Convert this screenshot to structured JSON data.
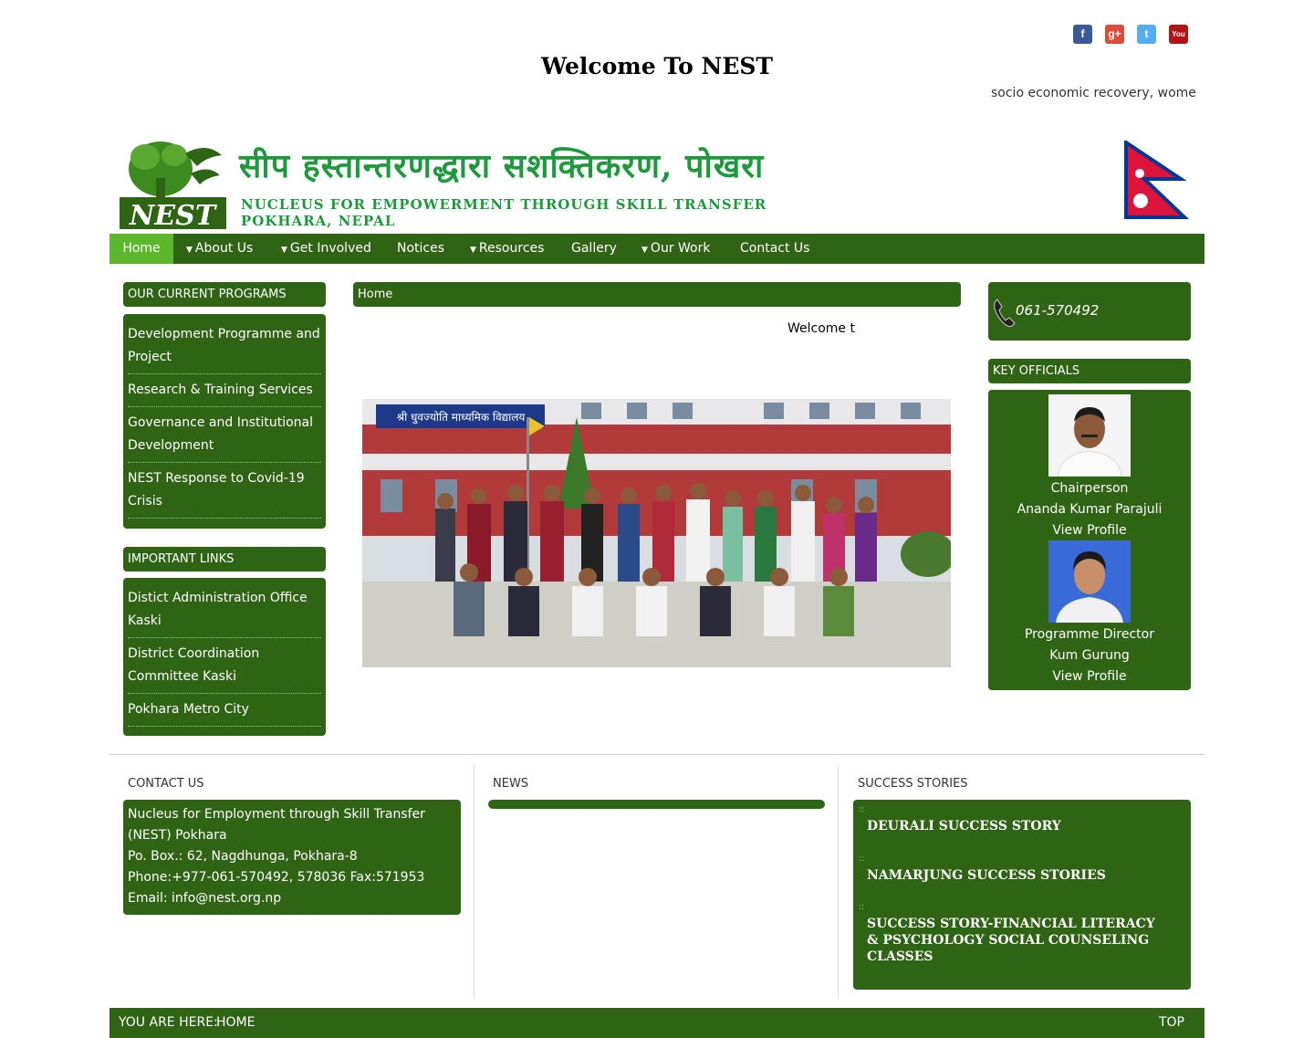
{
  "social": {
    "facebook_icon": "facebook-icon",
    "googleplus_icon": "googleplus-icon",
    "twitter_icon": "twitter-icon",
    "youtube_icon": "youtube-icon",
    "fb_glyph": "f",
    "gp_glyph": "g+",
    "tw_glyph": "t",
    "yt_glyph": "You"
  },
  "header": {
    "welcome_title": "Welcome To NEST",
    "marquee_text": "socio economic recovery, women",
    "nepali_title": "सीप हस्तान्तरणद्धारा सशक्तिकरण, पोखरा",
    "english_title_line1": "NUCLEUS FOR EMPOWERMENT THROUGH SKILL TRANSFER",
    "english_title_line2": "POKHARA, NEPAL",
    "logo_text": "NEST"
  },
  "nav": {
    "items": [
      {
        "label": "Home",
        "active": true,
        "dropdown": false
      },
      {
        "label": "About Us",
        "active": false,
        "dropdown": true
      },
      {
        "label": "Get Involved",
        "active": false,
        "dropdown": true
      },
      {
        "label": "Notices",
        "active": false,
        "dropdown": false
      },
      {
        "label": "Resources",
        "active": false,
        "dropdown": true
      },
      {
        "label": "Gallery",
        "active": false,
        "dropdown": false
      },
      {
        "label": "Our Work",
        "active": false,
        "dropdown": true
      },
      {
        "label": "Contact Us",
        "active": false,
        "dropdown": false
      }
    ]
  },
  "programs": {
    "heading": "OUR CURRENT PROGRAMS",
    "items": [
      "Development Programme and Project",
      "Research & Training Services",
      "Governance and Institutional Development",
      "NEST Response to Covid-19 Crisis"
    ]
  },
  "important_links": {
    "heading": "IMPORTANT LINKS",
    "items": [
      "Distict Administration Office Kaski",
      "District Coordination Committee Kaski",
      "Pokhara Metro City"
    ]
  },
  "main": {
    "breadcrumb": "Home",
    "marquee_text": "Welcome to",
    "school_sign": "श्री धुवज्योति माध्यमिक विद्यालय"
  },
  "contact_widget": {
    "phone_icon": "phone-icon",
    "phone": "061-570492"
  },
  "officials": {
    "heading": "KEY OFFICIALS",
    "people": [
      {
        "role": "Chairperson",
        "name": "Ananda Kumar Parajuli",
        "link": "View Profile"
      },
      {
        "role": "Programme Director",
        "name": "Kum Gurung",
        "link": "View Profile"
      }
    ]
  },
  "footer": {
    "contact_heading": "CONTACT US",
    "contact_lines": [
      "Nucleus for Employment through Skill Transfer (NEST) Pokhara",
      "Po. Box.: 62, Nagdhunga, Pokhara-8",
      "Phone:+977-061-570492, 578036 Fax:571953",
      "Email: info@nest.org.np"
    ],
    "news_heading": "NEWS",
    "stories_heading": "SUCCESS STORIES",
    "stories": [
      "DEURALI SUCCESS STORY",
      "NAMARJUNG SUCCESS STORIES",
      "SUCCESS STORY-FINANCIAL LITERACY & PSYCHOLOGY SOCIAL COUNSELING CLASSES"
    ],
    "bullet_glyph": "::"
  },
  "bottom_bar": {
    "you_are_here": "YOU ARE HERE:",
    "crumb": "HOME",
    "top_link": "TOP"
  },
  "colors": {
    "primary_green": "#2e6414",
    "active_nav": "#5cb82a",
    "title_green": "#1e9a3c"
  }
}
